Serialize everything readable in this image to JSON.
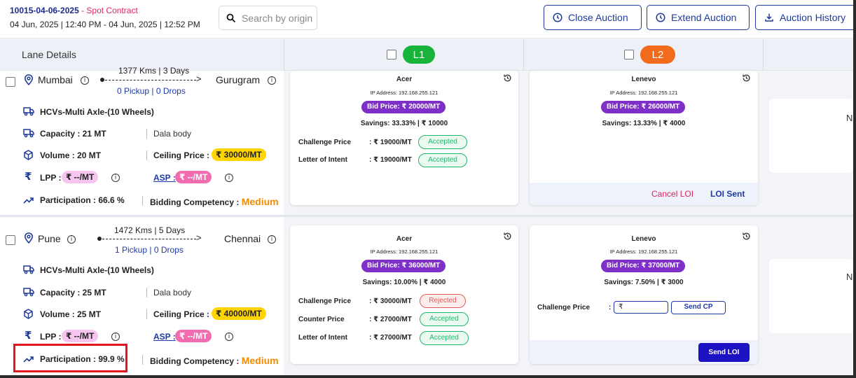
{
  "header": {
    "auction_id": "10015-04-06-2025",
    "auction_type": " - Spot Contract",
    "time_range": "04 Jun, 2025 | 12:40 PM - 04 Jun, 2025 | 12:52 PM",
    "search_placeholder": "Search by origin",
    "close_label": "Close Auction",
    "extend_label": "Extend Auction",
    "history_label": "Auction History"
  },
  "columns": {
    "lane_details": "Lane Details",
    "l1": "L1",
    "l2": "L2"
  },
  "lanes": [
    {
      "origin": "Mumbai",
      "destination": "Gurugram",
      "distance": "1377 Kms",
      "days": "3 Days",
      "pickup": "0 Pickup",
      "drops": "0 Drops",
      "vehicle": "HCVs-Multi Axle-(10 Wheels)",
      "capacity": "Capacity : 21 MT",
      "body": "Dala body",
      "volume": "Volume : 20 MT",
      "ceiling_label": "Ceiling Price :",
      "ceiling_value": "₹ 30000/MT",
      "lpp_label": "LPP :",
      "lpp_value": "₹ --/MT",
      "asp_label": "ASP :",
      "asp_value": "₹ --/MT",
      "participation": "Participation : 66.6 %",
      "competency_label": "Bidding Competency :",
      "competency_value": "Medium",
      "bids": [
        {
          "vendor": "Acer",
          "ip": "IP Address: 192.168.255.121",
          "bid": "Bid Price: ₹ 20000/MT",
          "savings_pct": "Savings: 33.33%",
          "savings_amt": "₹ 10000",
          "lines": [
            {
              "label": "Challenge Price",
              "value": ": ₹ 19000/MT",
              "status": "Accepted"
            },
            {
              "label": "Letter of Intent",
              "value": ": ₹ 19000/MT",
              "status": "Accepted"
            }
          ]
        },
        {
          "vendor": "Lenevo",
          "ip": "IP Address: 192.168.255.121",
          "bid": "Bid Price: ₹ 26000/MT",
          "savings_pct": "Savings: 13.33%",
          "savings_amt": "₹ 4000",
          "cancel_loi": "Cancel LOI",
          "loi_sent": "LOI Sent"
        }
      ],
      "ghost_text": "N"
    },
    {
      "origin": "Pune",
      "destination": "Chennai",
      "distance": "1472 Kms",
      "days": "5 Days",
      "pickup": "1 Pickup",
      "drops": "0 Drops",
      "vehicle": "HCVs-Multi Axle-(10 Wheels)",
      "capacity": "Capacity : 25 MT",
      "body": "Dala body",
      "volume": "Volume : 25 MT",
      "ceiling_label": "Ceiling Price :",
      "ceiling_value": "₹ 40000/MT",
      "lpp_label": "LPP :",
      "lpp_value": "₹ --/MT",
      "asp_label": "ASP :",
      "asp_value": "₹ --/MT",
      "participation": "Participation : 99.9 %",
      "competency_label": "Bidding Competency :",
      "competency_value": "Medium",
      "bids": [
        {
          "vendor": "Acer",
          "ip": "IP Address: 192.168.255.121",
          "bid": "Bid Price: ₹ 36000/MT",
          "savings_pct": "Savings: 10.00%",
          "savings_amt": "₹ 4000",
          "lines": [
            {
              "label": "Challenge Price",
              "value": ": ₹ 30000/MT",
              "status": "Rejected"
            },
            {
              "label": "Counter Price",
              "value": ": ₹ 27000/MT",
              "status": "Accepted"
            },
            {
              "label": "Letter of Intent",
              "value": ": ₹ 27000/MT",
              "status": "Accepted"
            }
          ]
        },
        {
          "vendor": "Lenevo",
          "ip": "IP Address: 192.168.255.121",
          "bid": "Bid Price: ₹ 37000/MT",
          "savings_pct": "Savings: 7.50%",
          "savings_amt": "₹ 3000",
          "cp_label": "Challenge Price",
          "cp_colon": ":",
          "cp_value": "₹",
          "send_cp": "Send CP",
          "send_loi": "Send LOI"
        }
      ],
      "ghost_text": "N"
    }
  ],
  "colors": {
    "primary": "#1e3a9a",
    "l1": "#17b33b",
    "l2": "#f26a1b",
    "bid": "#7e2fc7",
    "accepted": "#1fb86a",
    "rejected": "#e05b5b",
    "ceiling": "#ffd400",
    "medium": "#f28c00",
    "highlight": "#e3161b"
  }
}
